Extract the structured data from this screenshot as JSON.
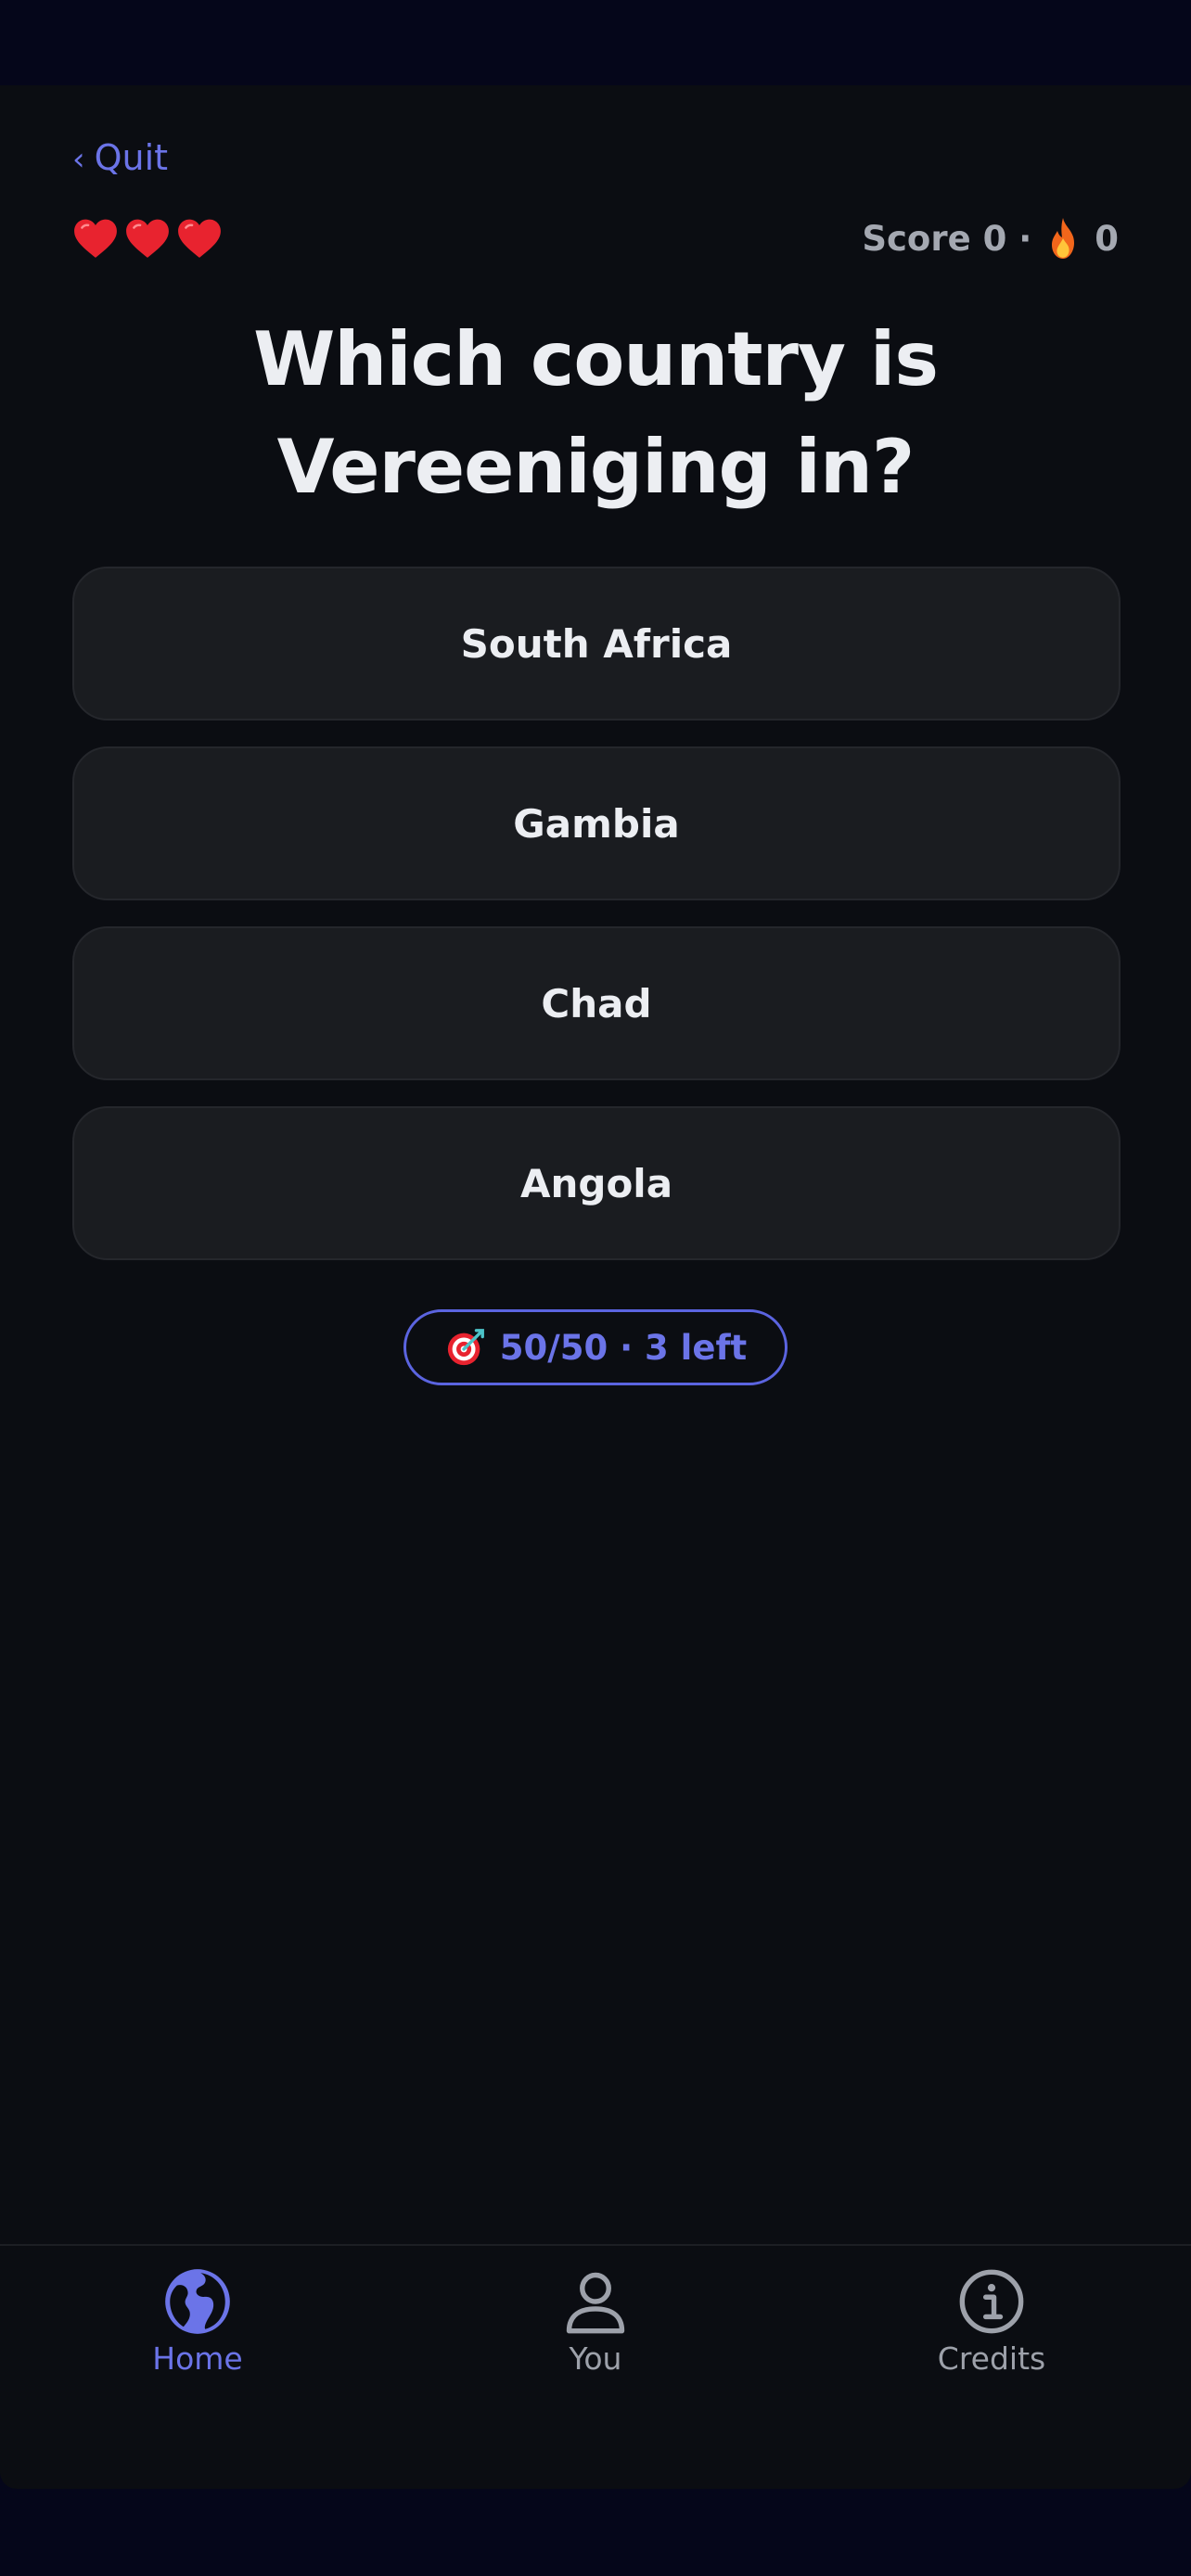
{
  "header": {
    "quit_chevron": "‹",
    "quit_label": "Quit"
  },
  "status": {
    "lives": 3,
    "score_text": "Score 0 ·",
    "streak": "0"
  },
  "question": {
    "text": "Which country is Vereeniging in?"
  },
  "options": [
    {
      "label": "South Africa"
    },
    {
      "label": "Gambia"
    },
    {
      "label": "Chad"
    },
    {
      "label": "Angola"
    }
  ],
  "lifeline": {
    "label": "50/50 · 3 left",
    "icon": "target-icon"
  },
  "tabs": [
    {
      "label": "Home",
      "icon": "globe-icon",
      "active": true
    },
    {
      "label": "You",
      "icon": "person-icon",
      "active": false
    },
    {
      "label": "Credits",
      "icon": "info-icon",
      "active": false
    }
  ],
  "colors": {
    "accent": "#6b74e8",
    "background": "#0b0d12",
    "card": "#1a1c20",
    "heart": "#e8232f"
  }
}
